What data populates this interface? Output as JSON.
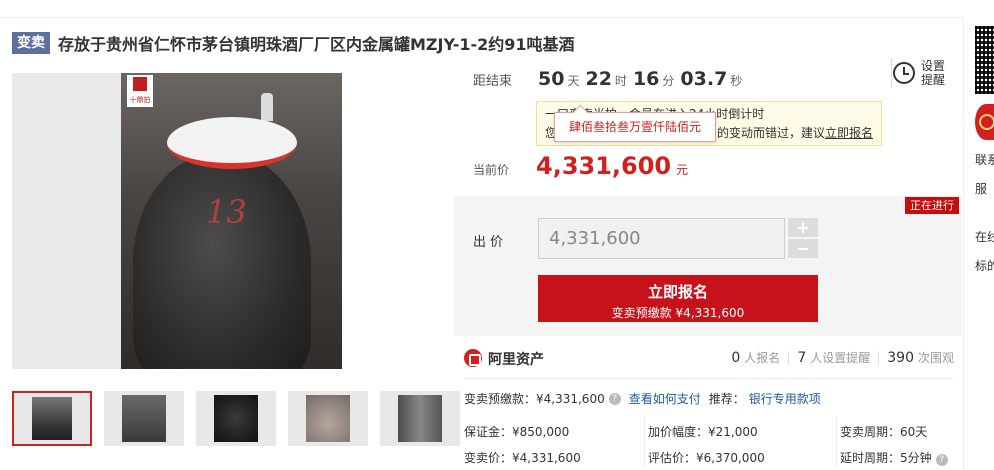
{
  "header": {
    "badge": "变卖",
    "title": "存放于贵州省仁怀市茅台镇明珠酒厂厂区内金属罐MZJY-1-2约91吨基酒"
  },
  "gallery": {
    "logo_text": "十鼎拍",
    "jar_mark": "13",
    "thumbs": [
      "thumb-1",
      "thumb-2",
      "thumb-3",
      "thumb-4",
      "thumb-5"
    ]
  },
  "countdown": {
    "label": "距结束",
    "days": "50",
    "days_unit": "天",
    "hours": "22",
    "hours_unit": "时",
    "minutes": "16",
    "minutes_unit": "分",
    "seconds": "03.7",
    "seconds_unit": "秒"
  },
  "reminder": {
    "label": "设置提醒"
  },
  "notice": {
    "line1": "一口变卖当拍…会员在进入24小时倒计时",
    "line2_prefix": "您",
    "line2": "的变动而错过，建议",
    "link": "立即报名"
  },
  "tooltip": {
    "text": "肆佰叁拾叁万壹仟陆佰元"
  },
  "price": {
    "label": "当前价",
    "value": "4,331,600",
    "unit": "元"
  },
  "status": {
    "ongoing": "正在进行"
  },
  "bid": {
    "label": "出价",
    "value": "4,331,600",
    "plus": "+",
    "minus": "−",
    "signup_label": "立即报名",
    "signup_sub": "变卖预缴款 ¥4,331,600"
  },
  "platform": {
    "name": "阿里资产",
    "signups_num": "0",
    "signups_label": "人报名",
    "reminders_num": "7",
    "reminders_label": "人设置提醒",
    "views_num": "390",
    "views_label": "次围观"
  },
  "details": {
    "prepay": "变卖预缴款：¥4,331,600",
    "how_to_pay": "查看如何支付",
    "recommend_label": "推荐：",
    "recommend_link": "银行专用款项",
    "deposit": "保证金：¥850,000",
    "increment": "加价幅度：¥21,000",
    "period": "变卖周期：60天",
    "sale_price": "变卖价：¥4,331,600",
    "appraisal": "评估价：¥6,370,000",
    "delay": "延时周期：5分钟"
  },
  "sidebar": {
    "contact": "联系",
    "service": "服",
    "online": "在线",
    "target": "标的"
  },
  "colors": {
    "accent_red": "#c8121b",
    "badge_blue": "#5c6f9e",
    "link_blue": "#1c5aa8"
  }
}
